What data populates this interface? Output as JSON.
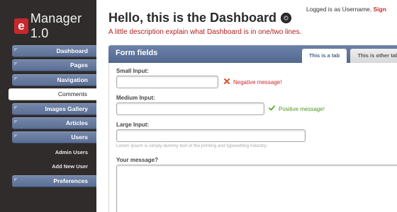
{
  "app": {
    "logo_letter": "e",
    "name": "Manager 1.0"
  },
  "header": {
    "title": "Hello, this is the Dashboard",
    "description": "A little description explain what Dashboard is in one/two lines.",
    "login_text": "Logged is as Username,",
    "signout_label": "Sign"
  },
  "sidebar": {
    "items": [
      {
        "label": "Dashboard"
      },
      {
        "label": "Pages"
      },
      {
        "label": "Navigation"
      },
      {
        "label": "Comments"
      },
      {
        "label": "Images Gallery"
      },
      {
        "label": "Articles"
      },
      {
        "label": "Users"
      },
      {
        "label": "Admin Users"
      },
      {
        "label": "Add New User"
      },
      {
        "label": "Preferences"
      }
    ]
  },
  "panel": {
    "title": "Form fields",
    "tabs": [
      {
        "label": "This is a tab"
      },
      {
        "label": "This is other tab"
      }
    ]
  },
  "form": {
    "small_label": "Small Input:",
    "small_value": "",
    "small_message": "Negative message!",
    "medium_label": "Medium Input:",
    "medium_value": "",
    "medium_message": "Positive message!",
    "large_label": "Large Input:",
    "large_value": "",
    "large_hint": "Lorem Ipsum is simply dummy text of the printing and typesetting industry.",
    "message_label": "Your message?",
    "message_value": ""
  },
  "colors": {
    "accent_red": "#c8282c",
    "nav_blue": "#5b6e94",
    "positive_green": "#4d9a1c",
    "sidebar_dark": "#2f2c2b"
  }
}
